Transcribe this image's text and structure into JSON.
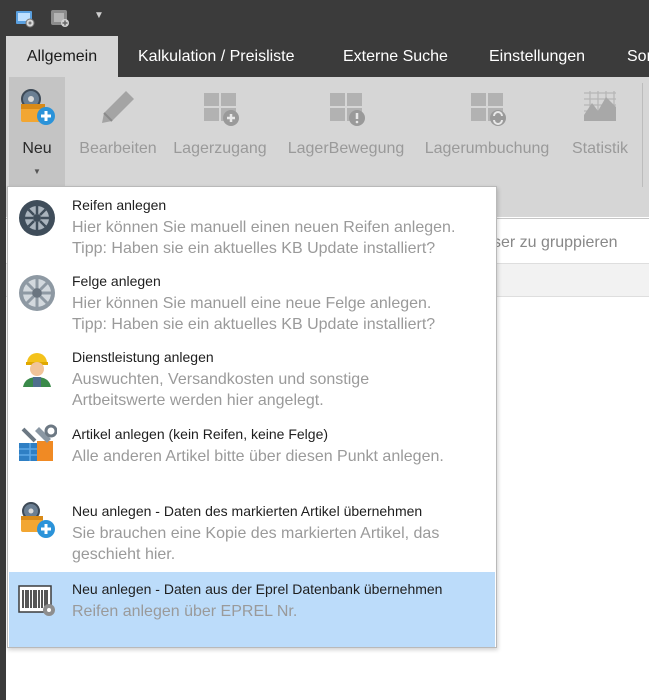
{
  "quick_access": [
    {
      "icon": "app-settings-icon"
    },
    {
      "icon": "add-item-icon"
    },
    {
      "icon": "chevron-down-icon"
    }
  ],
  "tabs": [
    {
      "label": "Allgemein",
      "active": true
    },
    {
      "label": "Kalkulation / Preisliste"
    },
    {
      "label": "Externe Suche"
    },
    {
      "label": "Einstellungen"
    },
    {
      "label": "Sor"
    }
  ],
  "ribbon": {
    "new": {
      "label": "Neu",
      "icon": "new-item-icon"
    },
    "edit": {
      "label": "Bearbeiten",
      "icon": "pencil-icon"
    },
    "stock_in": {
      "label": "Lagerzugang",
      "icon": "stock-add-icon"
    },
    "stock_move": {
      "label": "LagerBewegung",
      "icon": "stock-move-icon"
    },
    "stock_rebook": {
      "label": "Lagerumbuchung",
      "icon": "stock-rebook-icon"
    },
    "stats": {
      "label": "Statistik",
      "icon": "chart-icon"
    }
  },
  "group_hint": "ser zu gruppieren",
  "menu": {
    "items": [
      {
        "title": "Reifen anlegen",
        "desc1": "Hier können Sie manuell einen neuen Reifen anlegen.",
        "desc2": "Tipp: Haben sie ein aktuelles KB Update installiert?",
        "icon": "tire-icon"
      },
      {
        "title": "Felge anlegen",
        "desc1": "Hier können Sie manuell eine neue Felge anlegen.",
        "desc2": "Tipp: Haben sie ein aktuelles KB Update installiert?",
        "icon": "rim-icon"
      },
      {
        "title": "Dienstleistung anlegen",
        "desc1": "Auswuchten, Versandkosten und sonstige",
        "desc2": "Artbeitswerte werden hier angelegt.",
        "icon": "worker-icon"
      },
      {
        "title": "Artikel anlegen (kein Reifen, keine Felge)",
        "desc1": "Alle anderen Artikel bitte über diesen Punkt anlegen.",
        "desc2": "",
        "icon": "tools-icon"
      },
      {
        "title": "Neu anlegen - Daten des markierten Artikel übernehmen",
        "desc1": "Sie brauchen eine Kopie des markierten Artikel, das",
        "desc2": "geschieht hier.",
        "icon": "copy-item-icon"
      },
      {
        "title": "Neu anlegen - Daten aus der Eprel Datenbank übernehmen",
        "desc1": "Reifen anlegen über EPREL Nr.",
        "desc2": "",
        "icon": "barcode-icon",
        "highlighted": true
      }
    ]
  }
}
